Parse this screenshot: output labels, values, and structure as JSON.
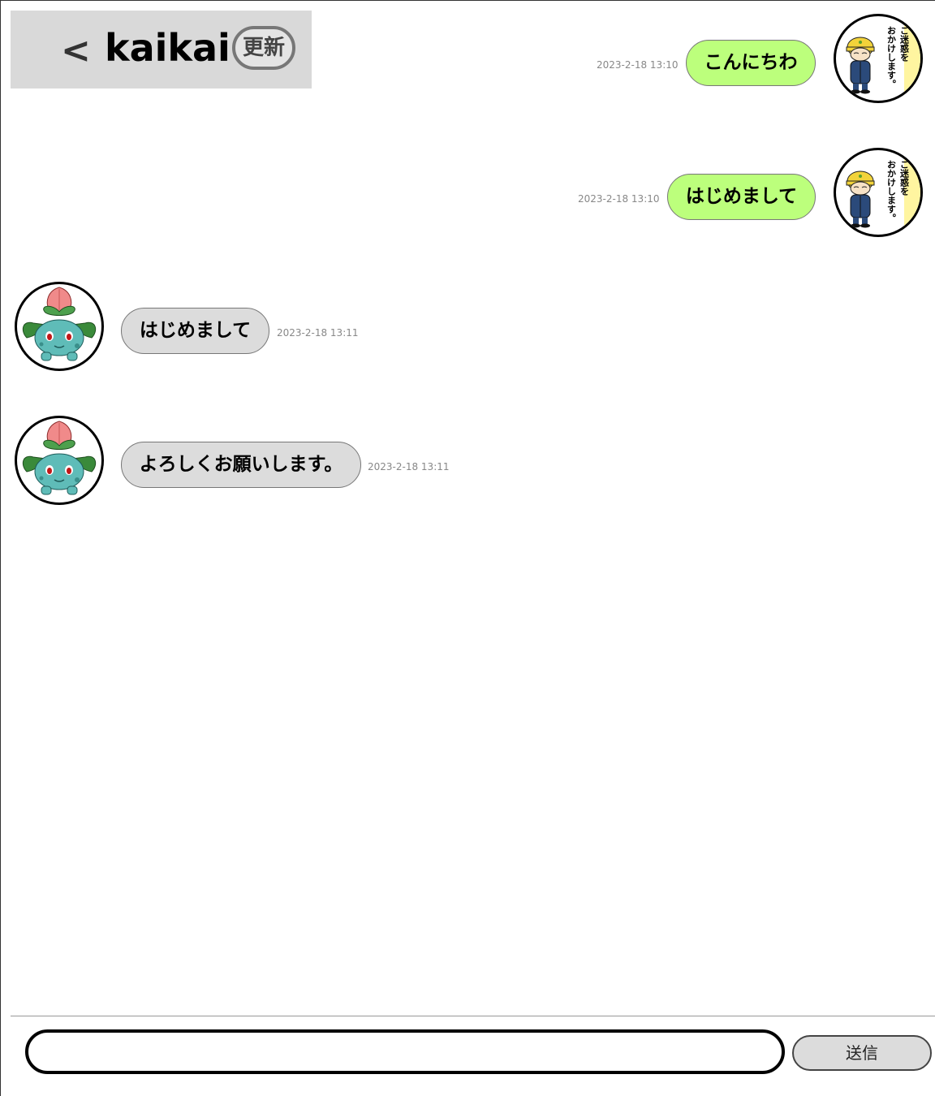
{
  "header": {
    "back_label": "<",
    "title": "kaikai",
    "refresh_label": "更新"
  },
  "messages": [
    {
      "sender": "me",
      "text": "こんにちわ",
      "time": "2023-2-18 13:10"
    },
    {
      "sender": "me",
      "text": "はじめまして",
      "time": "2023-2-18 13:10"
    },
    {
      "sender": "other",
      "text": "はじめまして",
      "time": "2023-2-18 13:11"
    },
    {
      "sender": "other",
      "text": "よろしくお願いします。",
      "time": "2023-2-18 13:11"
    }
  ],
  "my_avatar": {
    "icon": "apologizing-worker-avatar",
    "caption_lines": [
      "ご迷惑を",
      "おかけします。"
    ]
  },
  "other_avatar": {
    "icon": "plant-monster-avatar"
  },
  "composer": {
    "input_value": "",
    "input_placeholder": "",
    "send_label": "送信"
  },
  "colors": {
    "my_bubble": "#bcff7c",
    "their_bubble": "#dcdcdc",
    "header_bg": "#d9d9d9"
  }
}
